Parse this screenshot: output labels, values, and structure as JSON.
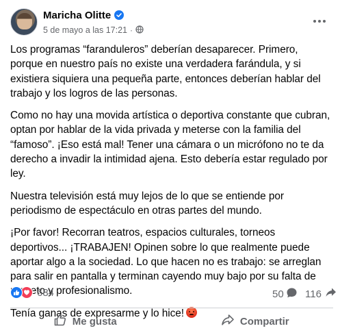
{
  "post": {
    "author": "Maricha Olitte",
    "timestamp": "5 de mayo a las 17:21",
    "separator": "·",
    "audience_icon": "globe-icon",
    "verified_icon": "verified-badge-icon",
    "more_icon": "more-options-icon"
  },
  "content": {
    "paragraphs": [
      "Los programas “faranduleros” deberían desaparecer. Primero, porque en nuestro país no existe una verdadera farándula, y si existiera siquiera una pequeña parte, entonces deberían hablar del trabajo y los logros de las personas.",
      "Como no hay una movida artística o deportiva constante que cubran, optan por hablar de la vida privada y meterse con la familia del “famoso”. ¡Eso está mal! Tener una cámara o un micrófono no te da derecho a invadir la intimidad ajena. Esto debería estar regulado por ley.",
      "Nuestra televisión está muy lejos de lo que se entiende por periodismo de espectáculo en otras partes del mundo.",
      "¡Por favor! Recorran teatros, espacios culturales, torneos deportivos... ¡TRABAJEN! Opinen sobre lo que realmente puede aportar algo a la sociedad. Lo que hacen no es trabajo: se arreglan para salir en pantalla y terminan cayendo muy bajo por su falta de respeto y profesionalismo.",
      "Tenía ganas de expresarme y lo hice!"
    ],
    "final_emoji": "angry-face-emoji"
  },
  "stats": {
    "reactions_count": "684",
    "reaction_types": [
      "like",
      "love"
    ],
    "comments_count": "50",
    "shares_count": "116"
  },
  "actions": {
    "like_label": "Me gusta",
    "share_label": "Compartir"
  },
  "colors": {
    "text": "#050505",
    "secondary_text": "#65676b",
    "brand_blue": "#1877f2",
    "love_red": "#f33e58",
    "divider": "#ced0d4"
  }
}
